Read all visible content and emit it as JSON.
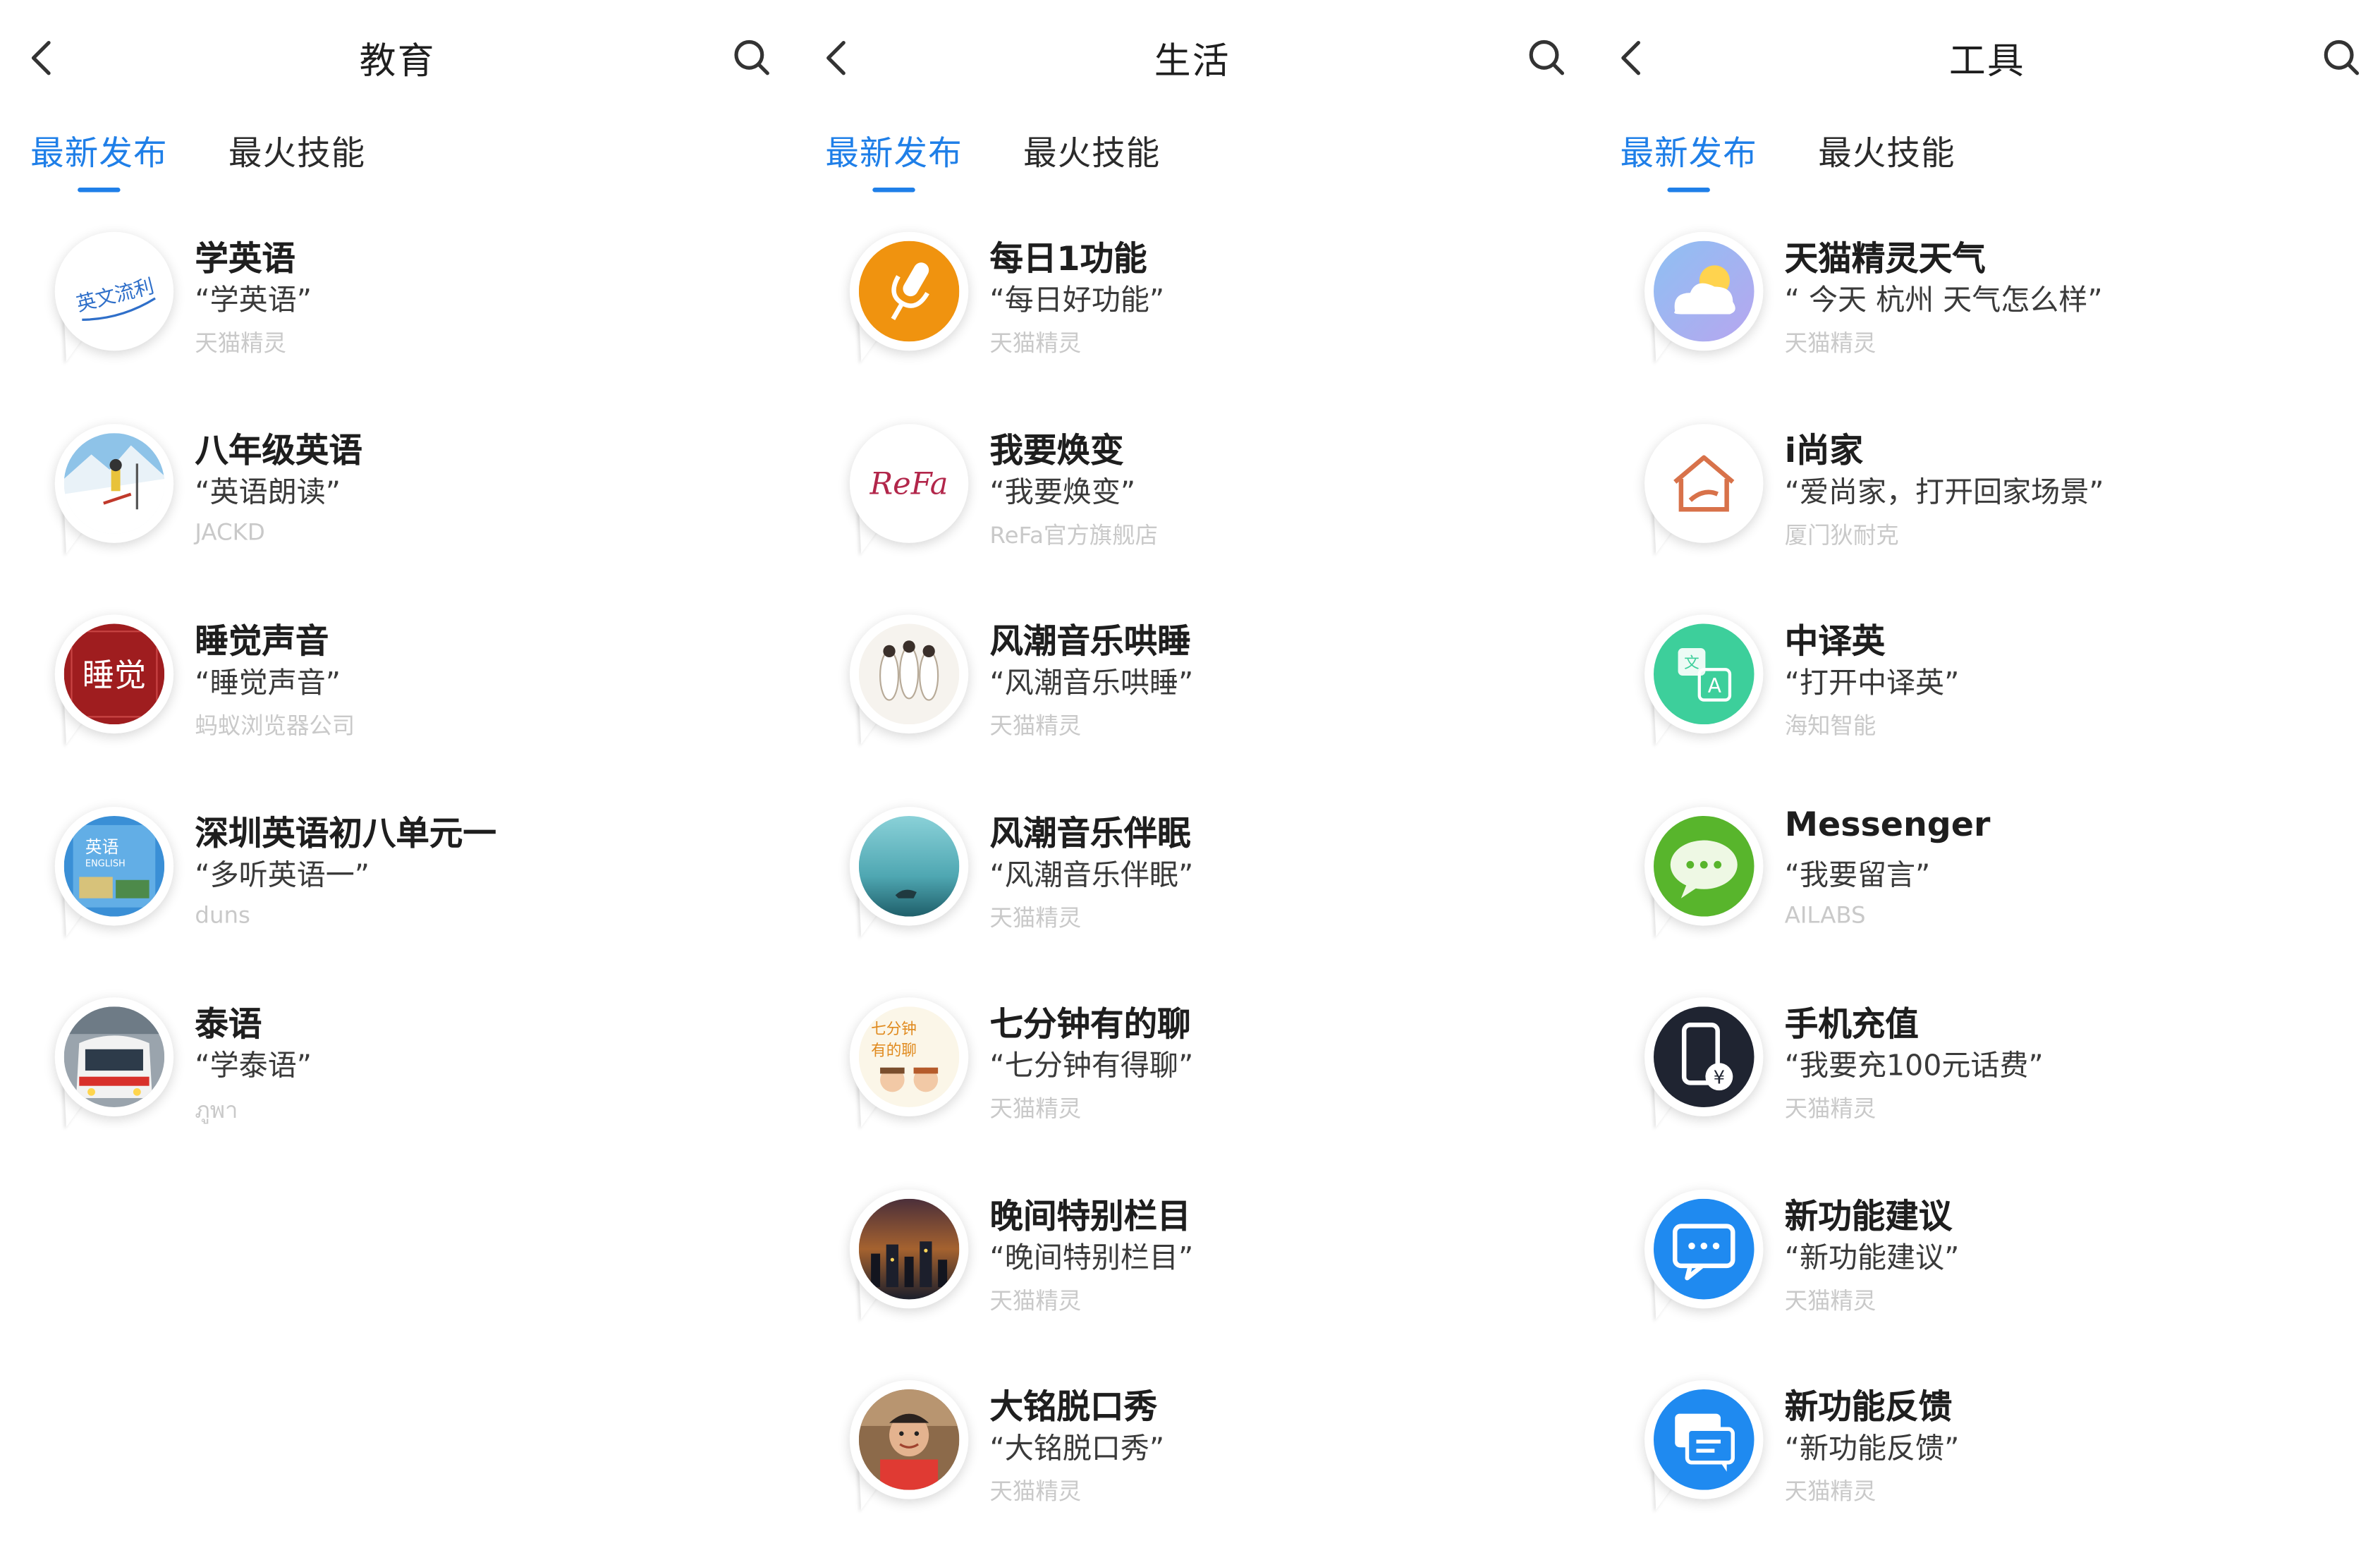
{
  "panels": [
    {
      "title": "教育",
      "tabs": {
        "new": "最新发布",
        "hot": "最火技能"
      },
      "items": [
        {
          "name": "学英语",
          "phrase": "“学英语”",
          "developer": "天猫精灵",
          "icon": "english-flow-icon"
        },
        {
          "name": "八年级英语",
          "phrase": "“英语朗读”",
          "developer": "JACKD",
          "icon": "skier-icon"
        },
        {
          "name": "睡觉声音",
          "phrase": "“睡觉声音”",
          "developer": "蚂蚁浏览器公司",
          "icon": "sleep-text-icon",
          "icon_text": "睡觉"
        },
        {
          "name": "深圳英语初八单元一",
          "phrase": "“多听英语一”",
          "developer": "duns",
          "icon": "english-textbook-icon",
          "icon_text": "英语"
        },
        {
          "name": "泰语",
          "phrase": "“学泰语”",
          "developer": "ภูพา",
          "icon": "train-icon"
        }
      ]
    },
    {
      "title": "生活",
      "tabs": {
        "new": "最新发布",
        "hot": "最火技能"
      },
      "items": [
        {
          "name": "每日1功能",
          "phrase": "“每日好功能”",
          "developer": "天猫精灵",
          "icon": "microphone-icon"
        },
        {
          "name": "我要焕变",
          "phrase": "“我要焕变”",
          "developer": "ReFa官方旗舰店",
          "icon": "refa-logo-icon",
          "icon_text": "ReFa"
        },
        {
          "name": "风潮音乐哄睡",
          "phrase": "“风潮音乐哄睡”",
          "developer": "天猫精灵",
          "icon": "sleeping-people-icon"
        },
        {
          "name": "风潮音乐伴眠",
          "phrase": "“风潮音乐伴眠”",
          "developer": "天猫精灵",
          "icon": "sea-landscape-icon"
        },
        {
          "name": "七分钟有的聊",
          "phrase": "“七分钟有得聊”",
          "developer": "天猫精灵",
          "icon": "chat-cartoon-icon",
          "icon_text": "七分钟有的聊"
        },
        {
          "name": "晚间特别栏目",
          "phrase": "“晚间特别栏目”",
          "developer": "天猫精灵",
          "icon": "night-city-icon"
        },
        {
          "name": "大铭脱口秀",
          "phrase": "“大铭脱口秀”",
          "developer": "天猫精灵",
          "icon": "portrait-icon"
        }
      ]
    },
    {
      "title": "工具",
      "tabs": {
        "new": "最新发布",
        "hot": "最火技能"
      },
      "items": [
        {
          "name": "天猫精灵天气",
          "phrase": "“ 今天  杭州 天气怎么样”",
          "developer": "天猫精灵",
          "icon": "weather-cloud-icon"
        },
        {
          "name": "i尚家",
          "phrase": "“爱尚家，打开回家场景”",
          "developer": "厦门狄耐克",
          "icon": "home-hand-icon"
        },
        {
          "name": "中译英",
          "phrase": "“打开中译英”",
          "developer": "海知智能",
          "icon": "translate-icon",
          "icon_text": "A"
        },
        {
          "name": "Messenger",
          "phrase": "“我要留言”",
          "developer": "AILABS",
          "icon": "message-bubble-icon"
        },
        {
          "name": "手机充值",
          "phrase": "“我要充100元话费”",
          "developer": "天猫精灵",
          "icon": "phone-recharge-icon",
          "icon_text": "¥"
        },
        {
          "name": "新功能建议",
          "phrase": "“新功能建议”",
          "developer": "天猫精灵",
          "icon": "suggestion-chat-icon"
        },
        {
          "name": "新功能反馈",
          "phrase": "“新功能反馈”",
          "developer": "天猫精灵",
          "icon": "feedback-chat-icon"
        }
      ]
    }
  ],
  "colors": {
    "accent": "#1f7fe8",
    "title": "#1f1f1f",
    "developer": "#c9c9c9"
  }
}
